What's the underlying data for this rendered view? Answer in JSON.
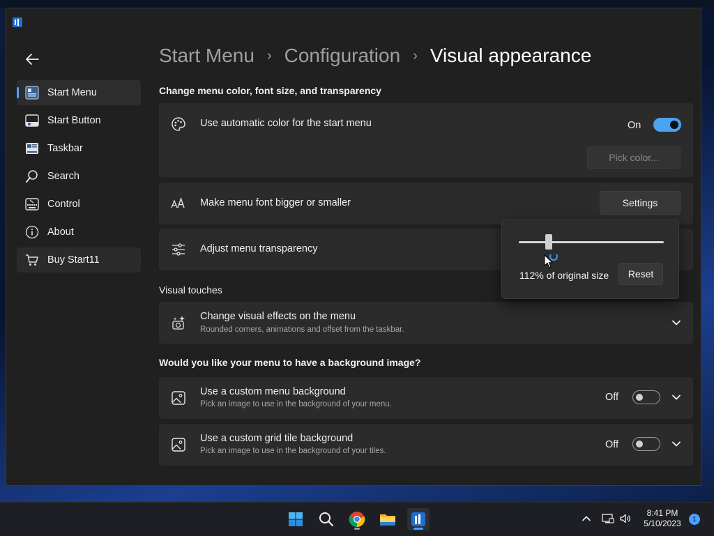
{
  "breadcrumb": {
    "items": [
      "Start Menu",
      "Configuration",
      "Visual appearance"
    ]
  },
  "sidebar": {
    "items": [
      {
        "label": "Start Menu",
        "icon": "start-menu-icon",
        "active": true
      },
      {
        "label": "Start Button",
        "icon": "start-button-icon"
      },
      {
        "label": "Taskbar",
        "icon": "taskbar-icon"
      },
      {
        "label": "Search",
        "icon": "search-icon"
      },
      {
        "label": "Control",
        "icon": "keyboard-icon"
      },
      {
        "label": "About",
        "icon": "info-icon"
      },
      {
        "label": "Buy Start11",
        "icon": "cart-icon"
      }
    ]
  },
  "section1": {
    "title": "Change menu color, font size, and transparency"
  },
  "auto_color": {
    "title": "Use automatic color for the start menu",
    "toggle_label": "On",
    "toggle_on": true,
    "pick_label": "Pick color..."
  },
  "font_size": {
    "title": "Make menu font bigger or smaller",
    "settings_label": "Settings"
  },
  "transparency": {
    "title": "Adjust menu transparency"
  },
  "flyout": {
    "size_text": "112% of original size",
    "reset_label": "Reset",
    "slider_percent": 112
  },
  "section2": {
    "title": "Visual touches"
  },
  "visual_effects": {
    "title": "Change visual effects on the menu",
    "subtitle": "Rounded corners, animations and offset from the taskbar."
  },
  "section3": {
    "title": "Would you like your menu to have a background image?"
  },
  "custom_bg": {
    "title": "Use a custom menu background",
    "subtitle": "Pick an image to use in the background of your menu.",
    "toggle_label": "Off",
    "toggle_on": false
  },
  "grid_bg": {
    "title": "Use a custom grid tile background",
    "subtitle": "Pick an image to use in the background of your tiles.",
    "toggle_label": "Off",
    "toggle_on": false
  },
  "taskbar": {
    "clock_time": "8:41 PM",
    "clock_date": "5/10/2023",
    "notification_count": "1"
  },
  "colors": {
    "accent": "#4ca0ff",
    "toggle_on": "#4aa3f0",
    "background": "#202020",
    "card": "#2b2b2b"
  }
}
